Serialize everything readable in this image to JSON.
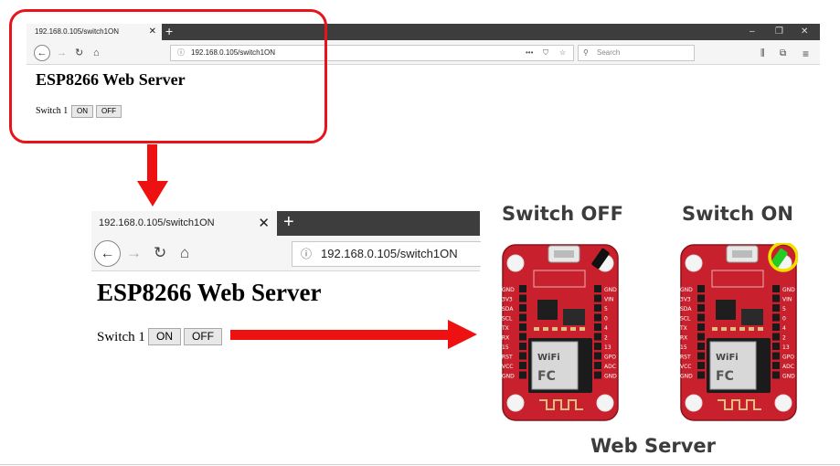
{
  "small_browser": {
    "tab_title": "192.168.0.105/switch1ON",
    "tab_close": "✕",
    "new_tab": "+",
    "window_controls": [
      "–",
      "❐",
      "✕"
    ],
    "url": "192.168.0.105/switch1ON",
    "url_info": "ⓘ",
    "url_actions": [
      "•••",
      "⛉",
      "☆"
    ],
    "search_placeholder": "Search",
    "toolbar_icons": [
      "⫼",
      "⧉",
      "≡"
    ],
    "heading": "ESP8266 Web Server",
    "switch_label": "Switch 1",
    "on_label": "ON",
    "off_label": "OFF"
  },
  "large_browser": {
    "tab_title": "192.168.0.105/switch1ON",
    "tab_close": "✕",
    "new_tab": "+",
    "url": "192.168.0.105/switch1ON",
    "url_info": "ⓘ",
    "heading": "ESP8266 Web Server",
    "switch_label": "Switch 1",
    "on_label": "ON",
    "off_label": "OFF"
  },
  "nav_glyphs": {
    "back": "←",
    "forward": "→",
    "reload": "↻",
    "home": "⌂"
  },
  "boards": {
    "off_title": "Switch OFF",
    "on_title": "Switch ON",
    "pins_left": [
      "GND",
      "3V3",
      "SDA",
      "SCL",
      "TX",
      "RX",
      "15",
      "RST",
      "VCC",
      "GND"
    ],
    "pins_right": [
      "GND",
      "VIN",
      "5",
      "0",
      "4",
      "2",
      "13",
      "GPO",
      "ADC",
      "GND"
    ],
    "wifi_label": "WiFi",
    "fcc_label": "FC",
    "led_off_color": "#111111",
    "led_on_color": "#22cc22",
    "highlight_color": "#f0e000"
  },
  "caption": "Web Server",
  "colors": {
    "accent_red": "#e8141b",
    "board_red": "#c8202c"
  }
}
